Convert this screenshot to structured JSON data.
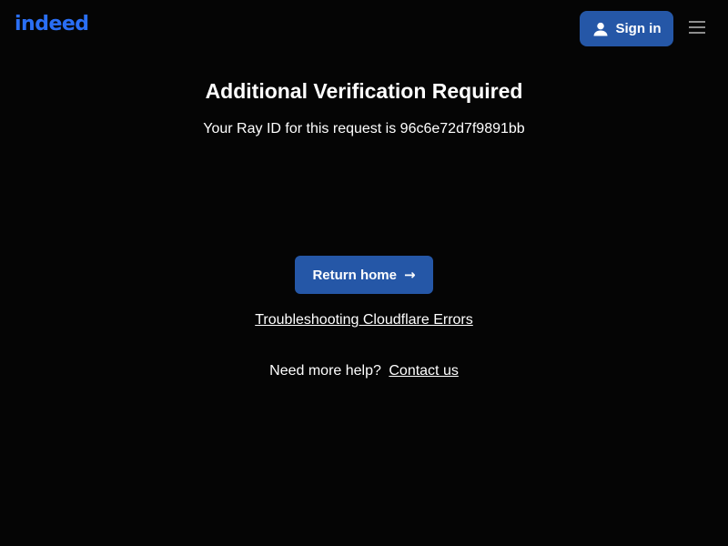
{
  "header": {
    "logo_text": "indeed",
    "signin_label": "Sign in",
    "icons": {
      "signin": "person-icon",
      "menu": "hamburger-menu-icon"
    }
  },
  "main": {
    "title": "Additional Verification Required",
    "ray_text": "Your Ray ID for this request is 96c6e72d7f9891bb",
    "return_label": "Return home",
    "return_arrow": "→",
    "troubleshooting_link": "Troubleshooting Cloudflare Errors",
    "help_prefix": "Need more help?",
    "contact_link": "Contact us"
  },
  "colors": {
    "background": "#050505",
    "brand_blue": "#2557a7",
    "logo_blue": "#2a6ff5",
    "text": "#ffffff"
  }
}
